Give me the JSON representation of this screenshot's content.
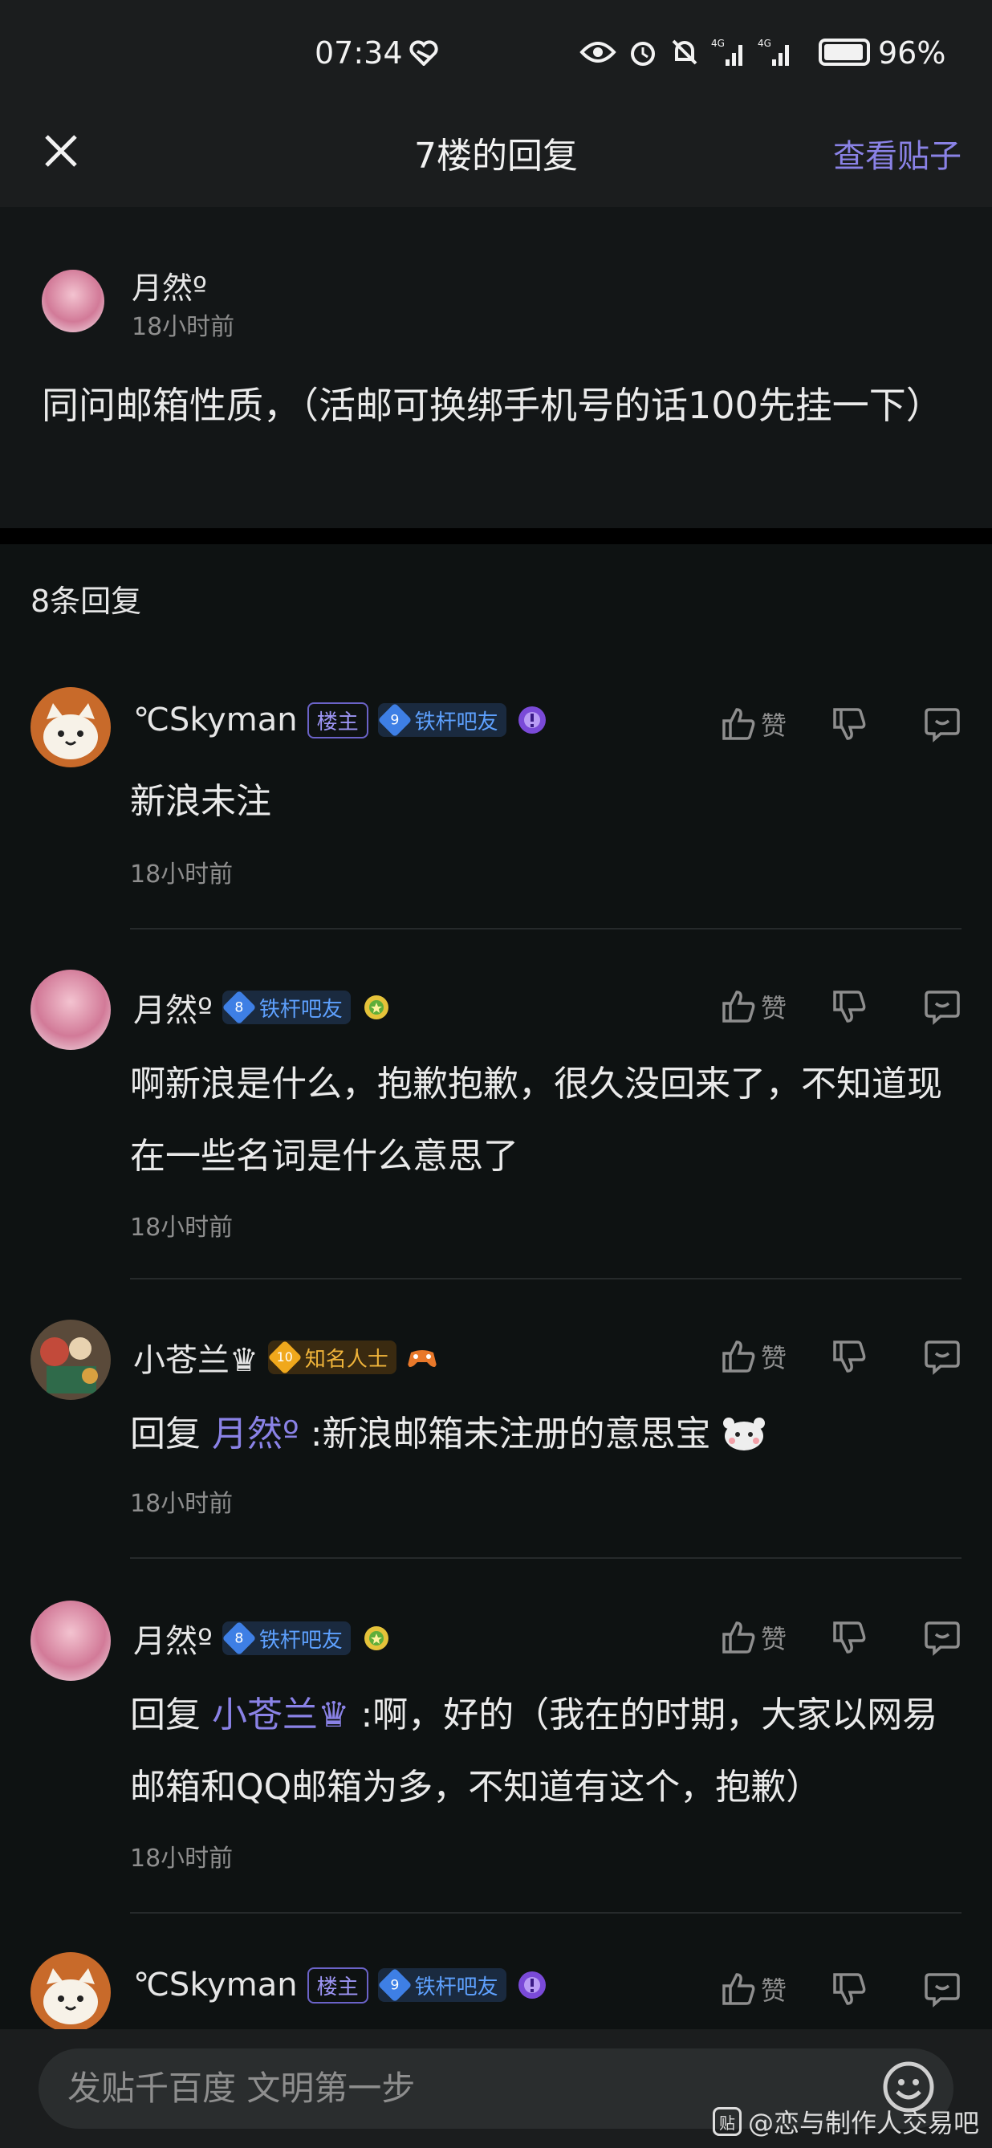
{
  "status_bar": {
    "time": "07:34",
    "battery_percent": "96%",
    "battery_level": 0.96,
    "network": "4G"
  },
  "header": {
    "title": "7楼的回复",
    "view_post": "查看贴子"
  },
  "floor": {
    "author": "月然º",
    "time": "18小时前",
    "content": "同问邮箱性质，（活邮可换绑手机号的话100先挂一下）"
  },
  "reply_count": "8条回复",
  "action_labels": {
    "like": "赞"
  },
  "replies": [
    {
      "author": "℃Skyman",
      "host_badge": "楼主",
      "level": "9",
      "level_title": "铁杆吧友",
      "text": "新浪未注",
      "time": "18小时前"
    },
    {
      "author": "月然º",
      "level": "8",
      "level_title": "铁杆吧友",
      "text": "啊新浪是什么，抱歉抱歉，很久没回来了，不知道现在一些名词是什么意思了",
      "time": "18小时前"
    },
    {
      "author": "小苍兰♛",
      "level": "10",
      "level_title": "知名人士",
      "reply_prefix": "回复 ",
      "mention": "月然º",
      "text": " :新浪邮箱未注册的意思宝",
      "time": "18小时前"
    },
    {
      "author": "月然º",
      "level": "8",
      "level_title": "铁杆吧友",
      "reply_prefix": "回复 ",
      "mention": "小苍兰♛",
      "text": " :啊，好的（我在的时期，大家以网易邮箱和QQ邮箱为多，不知道有这个，抱歉）",
      "time": "18小时前"
    },
    {
      "author": "℃Skyman",
      "host_badge": "楼主",
      "level": "9",
      "level_title": "铁杆吧友"
    }
  ],
  "composer": {
    "placeholder": "发贴千百度 文明第一步"
  },
  "watermark": {
    "logo": "贴",
    "text": "@恋与制作人交易吧"
  },
  "colors": {
    "accent": "#8a82e6",
    "background": "#0e1212",
    "level_blue": "#3e7fe5",
    "level_gold": "#f0a81c"
  }
}
